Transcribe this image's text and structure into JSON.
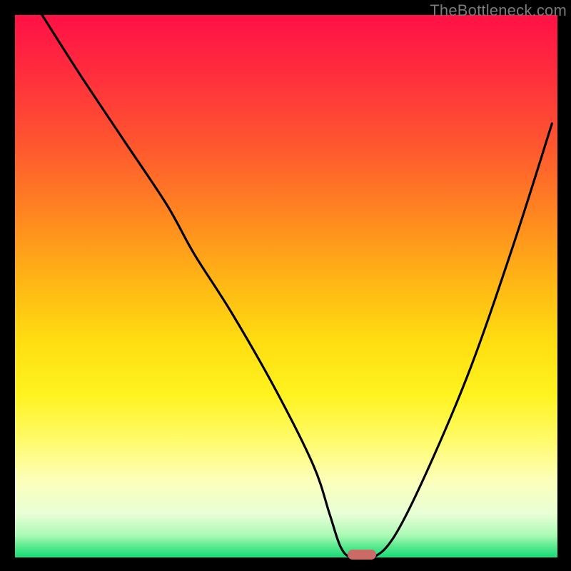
{
  "watermark": "TheBottleneck.com",
  "chart_data": {
    "type": "line",
    "title": "",
    "xlabel": "",
    "ylabel": "",
    "xlim": [
      0,
      100
    ],
    "ylim": [
      0,
      100
    ],
    "series": [
      {
        "name": "curve",
        "x": [
          5,
          12,
          20,
          28,
          33,
          40,
          48,
          55,
          58,
          60,
          62,
          66,
          70,
          76,
          84,
          92,
          99
        ],
        "y": [
          100,
          89,
          77,
          65,
          56,
          45,
          31,
          17,
          8,
          2,
          0,
          0,
          4,
          16,
          35,
          58,
          80
        ]
      }
    ],
    "marker": {
      "x": 64,
      "y": 0
    },
    "colors": {
      "curve": "#000000",
      "marker": "#cc6b66",
      "frame": "#000000"
    }
  }
}
